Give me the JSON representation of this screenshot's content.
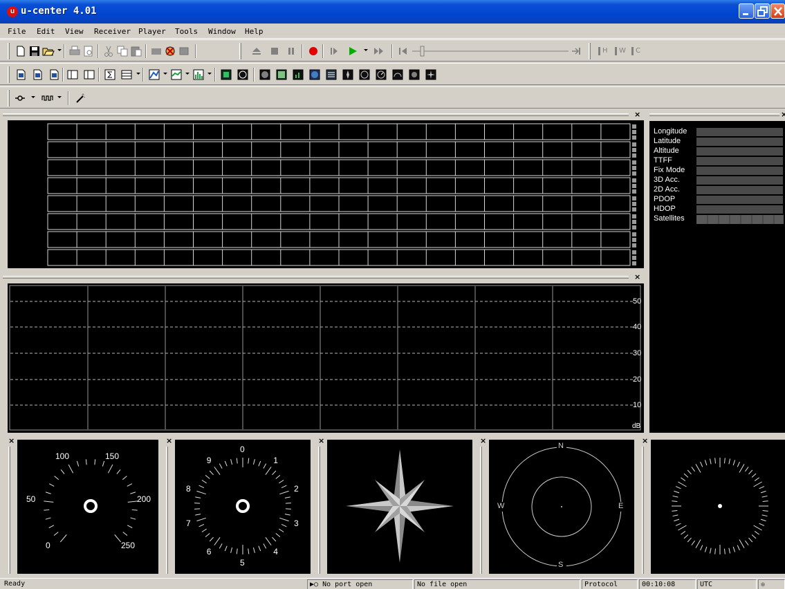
{
  "window": {
    "title": "u-center 4.01",
    "app_icon_letter": "u"
  },
  "menu": [
    "File",
    "Edit",
    "View",
    "Receiver",
    "Player",
    "Tools",
    "Window",
    "Help"
  ],
  "toolbar": {
    "log_labels": [
      "H",
      "W",
      "C"
    ]
  },
  "navigation_panel": {
    "labels": [
      "Longitude",
      "Latitude",
      "Altitude",
      "TTFF",
      "Fix Mode",
      "3D Acc.",
      "2D Acc.",
      "PDOP",
      "HDOP",
      "Satellites"
    ]
  },
  "signal_panel": {
    "y_ticks": [
      "50",
      "40",
      "30",
      "20",
      "10"
    ],
    "unit": "dB"
  },
  "gauges": {
    "speedometer_ticks": [
      "100",
      "150",
      "50",
      "200",
      "0",
      "250"
    ],
    "altimeter_ticks": [
      "0",
      "1",
      "2",
      "3",
      "4",
      "5",
      "6",
      "7",
      "8",
      "9"
    ],
    "compass_labels": [
      "N",
      "E",
      "S",
      "W"
    ]
  },
  "status": {
    "ready": "Ready",
    "port": "No port open",
    "file": "No file open",
    "protocol": "Protocol",
    "time": "00:10:08",
    "timezone": "UTC"
  },
  "colors": {
    "title_bar": "#0a4fd4",
    "record": "#e00000",
    "play": "#00b000",
    "panel_bg": "#000000"
  }
}
